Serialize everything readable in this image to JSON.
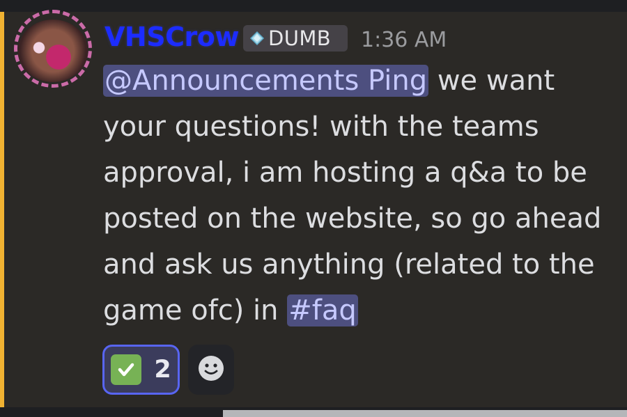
{
  "message": {
    "username": "VHSCrow",
    "role": "DUMB",
    "timestamp": "1:36 AM",
    "mention": "@Announcements Ping",
    "text_part1": "we want your questions! with the teams approval, i am hosting a q&a to be posted on the website, so go ahead and ask us anything (related to the game ofc) in",
    "channel": "#faq"
  },
  "reactions": {
    "check_count": "2"
  },
  "icons": {
    "role_icon": "diamond-icon",
    "reaction_icon": "check-mark-icon",
    "add_reaction_icon": "smiley-icon"
  },
  "colors": {
    "username": "#1c2cff",
    "mention_bg": "#4d4f7f",
    "highlight_bar": "#f0b232",
    "reaction_border": "#5865f2"
  }
}
